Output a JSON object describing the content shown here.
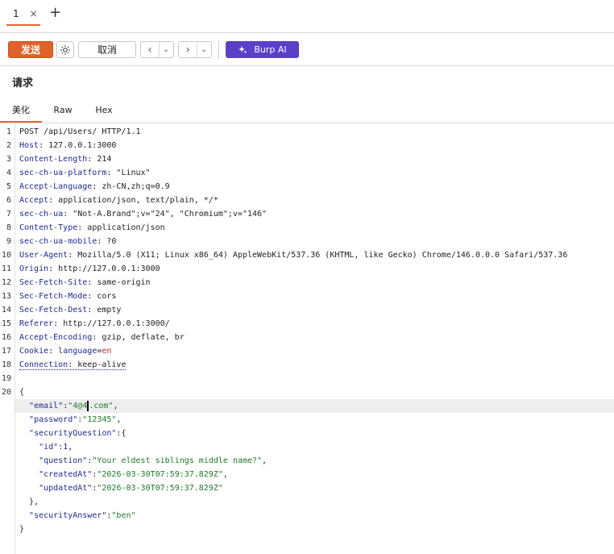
{
  "tabs": [
    {
      "label": "1",
      "close": "×"
    }
  ],
  "tab_add": "+",
  "toolbar": {
    "send_label": "发送",
    "cancel_label": "取消",
    "prev": "‹",
    "next": "›",
    "dropdown": "⌄",
    "ai_label": "Burp AI",
    "accent": "#e0622a",
    "ai_color": "#5b3fc7"
  },
  "section_title": "请求",
  "view_tabs": [
    "美化",
    "Raw",
    "Hex"
  ],
  "request": {
    "line_numbers": [
      "1",
      "2",
      "3",
      "4",
      "5",
      "6",
      "7",
      "8",
      "9",
      "10",
      "11",
      "12",
      "13",
      "14",
      "15",
      "16",
      "17",
      "18",
      "19",
      "20"
    ],
    "request_line": "POST /api/Users/ HTTP/1.1",
    "headers": [
      {
        "name": "Host",
        "value": "127.0.0.1:3000"
      },
      {
        "name": "Content-Length",
        "value": "214"
      },
      {
        "name": "sec-ch-ua-platform",
        "value": "\"Linux\""
      },
      {
        "name": "Accept-Language",
        "value": "zh-CN,zh;q=0.9"
      },
      {
        "name": "Accept",
        "value": "application/json, text/plain, */*"
      },
      {
        "name": "sec-ch-ua",
        "value": "\"Not-A.Brand\";v=\"24\", \"Chromium\";v=\"146\""
      },
      {
        "name": "Content-Type",
        "value": "application/json"
      },
      {
        "name": "sec-ch-ua-mobile",
        "value": "?0"
      },
      {
        "name": "User-Agent",
        "value": "Mozilla/5.0 (X11; Linux x86_64) AppleWebKit/537.36 (KHTML, like Gecko) Chrome/146.0.0.0 Safari/537.36"
      },
      {
        "name": "Origin",
        "value": "http://127.0.0.1:3000"
      },
      {
        "name": "Sec-Fetch-Site",
        "value": "same-origin"
      },
      {
        "name": "Sec-Fetch-Mode",
        "value": "cors"
      },
      {
        "name": "Sec-Fetch-Dest",
        "value": "empty"
      },
      {
        "name": "Referer",
        "value": "http://127.0.0.1:3000/"
      },
      {
        "name": "Accept-Encoding",
        "value": "gzip, deflate, br"
      }
    ],
    "cookie": {
      "name": "Cookie",
      "key": "language",
      "eq": "=",
      "val": "en"
    },
    "connection": {
      "name": "Connection",
      "value": "keep-alive"
    },
    "body": {
      "open": "{",
      "email_key": "\"email\"",
      "email_val_a": "\"4@4",
      "email_val_b": ".com\"",
      "password_key": "\"password\"",
      "password_val": "\"12345\"",
      "sq_key": "\"securityQuestion\"",
      "sq_open": ":{",
      "id_key": "\"id\"",
      "id_val": "1",
      "question_key": "\"question\"",
      "question_val": "\"Your eldest siblings middle name?\"",
      "created_key": "\"createdAt\"",
      "created_val": "\"2026-03-30T07:59:37.829Z\"",
      "updated_key": "\"updatedAt\"",
      "updated_val": "\"2026-03-30T07:59:37.829Z\"",
      "sq_close": "},",
      "answer_key": "\"securityAnswer\"",
      "answer_val": "\"ben\"",
      "close": "}"
    }
  }
}
